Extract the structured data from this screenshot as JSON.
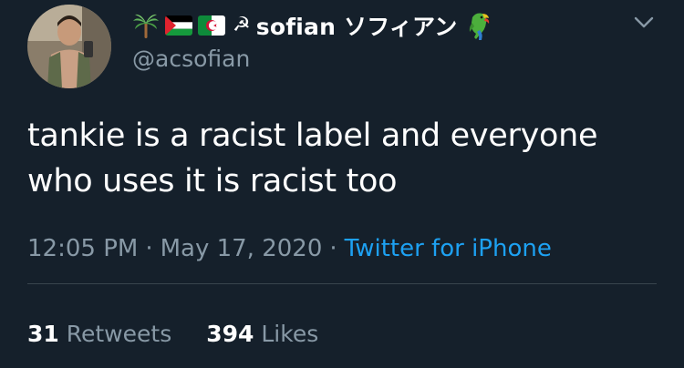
{
  "user": {
    "display_name": "sofian ソフィアン",
    "handle": "@acsofian",
    "name_emojis": [
      "palm-tree",
      "palestine-flag",
      "algeria-flag",
      "hammer-and-sickle",
      "parrot"
    ],
    "hammer_glyph": "☭"
  },
  "tweet": {
    "text_line1": "tankie is a racist label and everyone",
    "text_line2": "who uses it is racist too"
  },
  "meta": {
    "time": "12:05 PM",
    "separator": "·",
    "date": "May 17, 2020",
    "source": "Twitter for iPhone"
  },
  "stats": {
    "retweets_count": "31",
    "retweets_label": "Retweets",
    "likes_count": "394",
    "likes_label": "Likes"
  },
  "colors": {
    "background": "#15202b",
    "secondary_text": "#8899a6",
    "link": "#1da1f2",
    "divider": "#38444d"
  }
}
